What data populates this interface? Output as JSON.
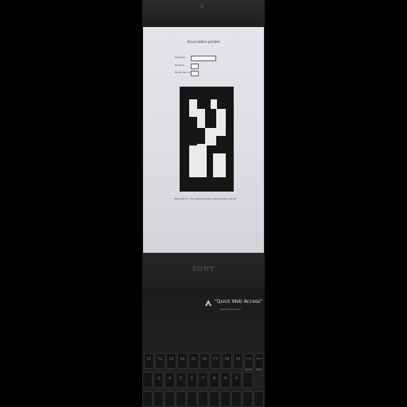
{
  "photo": {
    "screen": {
      "title": "Aruco tables printed",
      "fields": [
        {
          "label": "Dictionary",
          "value": ""
        },
        {
          "label": "Marker ID",
          "value": ""
        },
        {
          "label": "Marker size, mm",
          "value": ""
        }
      ],
      "caption": "Marker with ID — it's a legal size to print, marker preview to the left"
    },
    "brand": "SONY",
    "quick_web_access": {
      "label": "\"Quick Web Access\"",
      "sub": "allows starting Browser*"
    },
    "keys": [
      "F1",
      "F2",
      "F3",
      "F4",
      "F5",
      "F6",
      "F7",
      "F8",
      "F9",
      "Prt Sc Sys Rq",
      "Pause Break",
      "",
      "3",
      "4",
      "5",
      "6",
      "7",
      "8",
      "9",
      "0",
      "-"
    ],
    "colors": {
      "screen": "#e0e0e6",
      "bezel": "#1e201f",
      "marker": "#161616"
    }
  }
}
